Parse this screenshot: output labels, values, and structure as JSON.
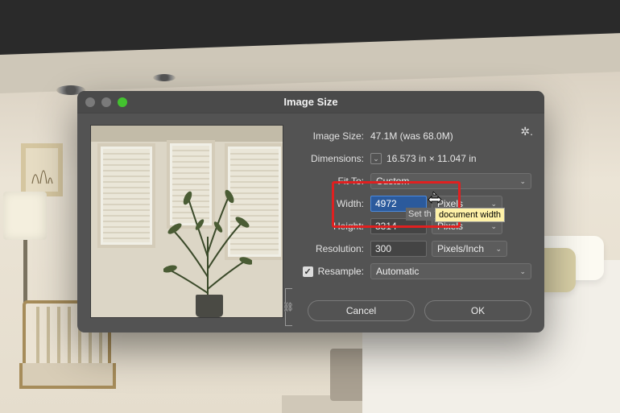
{
  "dialog": {
    "title": "Image Size",
    "image_size_label": "Image Size:",
    "image_size_value": "47.1M (was 68.0M)",
    "dimensions_label": "Dimensions:",
    "dimensions_value": "16.573 in  ×  11.047 in",
    "fit_to_label": "Fit To:",
    "fit_to_value": "Custom",
    "width_label": "Width:",
    "width_value": "4972",
    "width_unit": "Pixels",
    "height_label": "Height:",
    "height_value": "3314",
    "height_unit": "Pixels",
    "resolution_label": "Resolution:",
    "resolution_value": "300",
    "resolution_unit": "Pixels/Inch",
    "resample_label": "Resample:",
    "resample_checked": true,
    "resample_value": "Automatic",
    "cancel": "Cancel",
    "ok": "OK",
    "tooltip_pre": "Set th",
    "tooltip": "document width"
  }
}
